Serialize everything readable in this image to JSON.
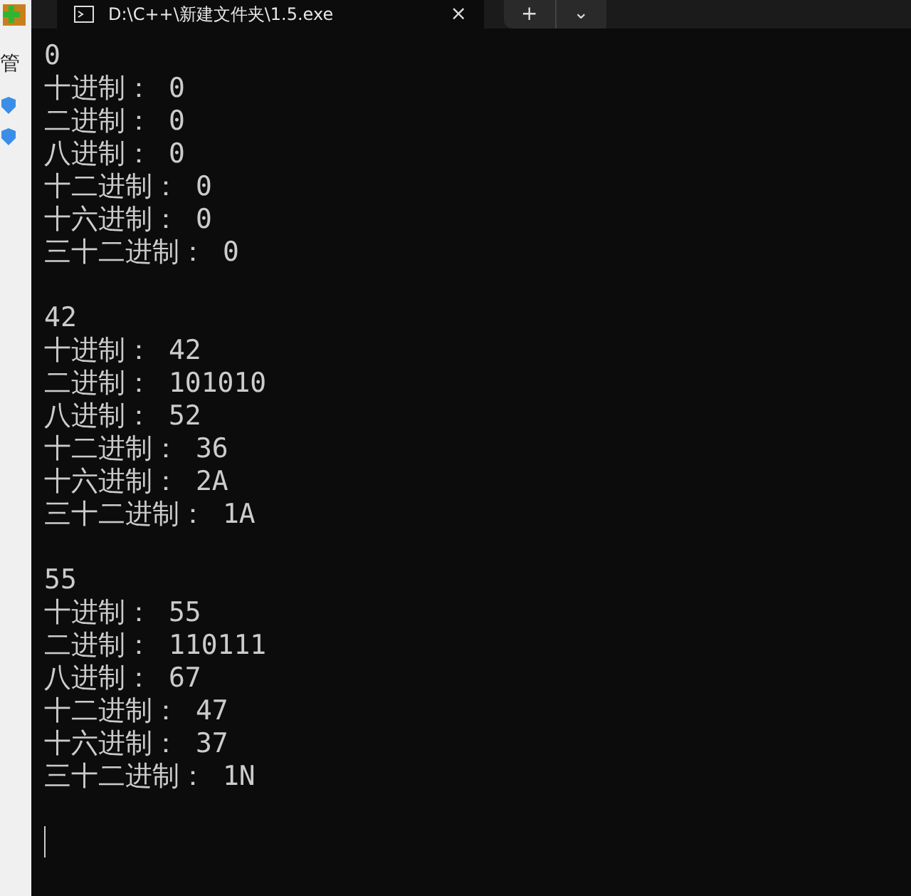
{
  "background_window": {
    "label": "管"
  },
  "tab": {
    "title": "D:\\C++\\新建文件夹\\1.5.exe",
    "close": "×"
  },
  "new_tab": "+",
  "tab_menu": "⌄",
  "blocks": [
    {
      "number": "0",
      "lines": [
        {
          "label": "十进制：",
          "value": "0"
        },
        {
          "label": "二进制：",
          "value": "0"
        },
        {
          "label": "八进制：",
          "value": "0"
        },
        {
          "label": "十二进制：",
          "value": "0"
        },
        {
          "label": "十六进制：",
          "value": "0"
        },
        {
          "label": "三十二进制：",
          "value": "0"
        }
      ]
    },
    {
      "number": "42",
      "lines": [
        {
          "label": "十进制：",
          "value": "42"
        },
        {
          "label": "二进制：",
          "value": "101010"
        },
        {
          "label": "八进制：",
          "value": "52"
        },
        {
          "label": "十二进制：",
          "value": "36"
        },
        {
          "label": "十六进制：",
          "value": "2A"
        },
        {
          "label": "三十二进制：",
          "value": "1A"
        }
      ]
    },
    {
      "number": "55",
      "lines": [
        {
          "label": "十进制：",
          "value": "55"
        },
        {
          "label": "二进制：",
          "value": "110111"
        },
        {
          "label": "八进制：",
          "value": "67"
        },
        {
          "label": "十二进制：",
          "value": "47"
        },
        {
          "label": "十六进制：",
          "value": "37"
        },
        {
          "label": "三十二进制：",
          "value": "1N"
        }
      ]
    }
  ]
}
